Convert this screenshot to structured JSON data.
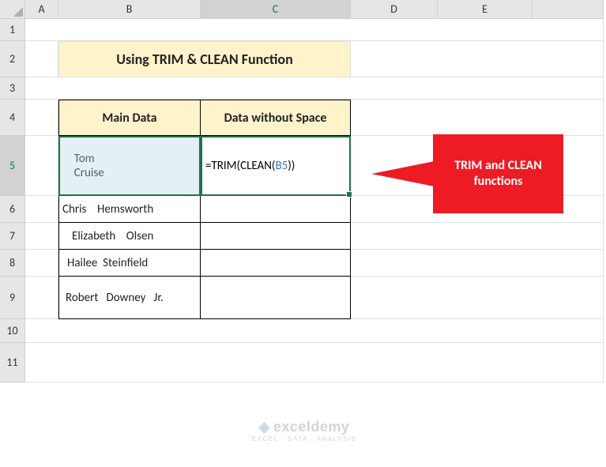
{
  "columns": [
    "A",
    "B",
    "C",
    "D",
    "E"
  ],
  "rows": [
    "1",
    "2",
    "3",
    "4",
    "5",
    "6",
    "7",
    "8",
    "9",
    "10",
    "11"
  ],
  "active_col_idx": 2,
  "active_row_idx": 4,
  "title": "Using TRIM & CLEAN Function",
  "headers": {
    "b": "Main Data",
    "c": "Data without Space"
  },
  "data": {
    "b5": "  Tom\n  Cruise",
    "b6": "Chris    Hemsworth",
    "b7": "Elizabeth    Olsen",
    "b8": "Hailee  Steinfield",
    "b9": "Robert   Downey   Jr."
  },
  "formula": {
    "prefix": "=TRIM(CLEAN(",
    "ref": "B5",
    "suffix": "))"
  },
  "callout": "TRIM and CLEAN functions",
  "watermark": {
    "brand": "exceldemy",
    "tag": "EXCEL · DATA · ANALYSIS"
  }
}
